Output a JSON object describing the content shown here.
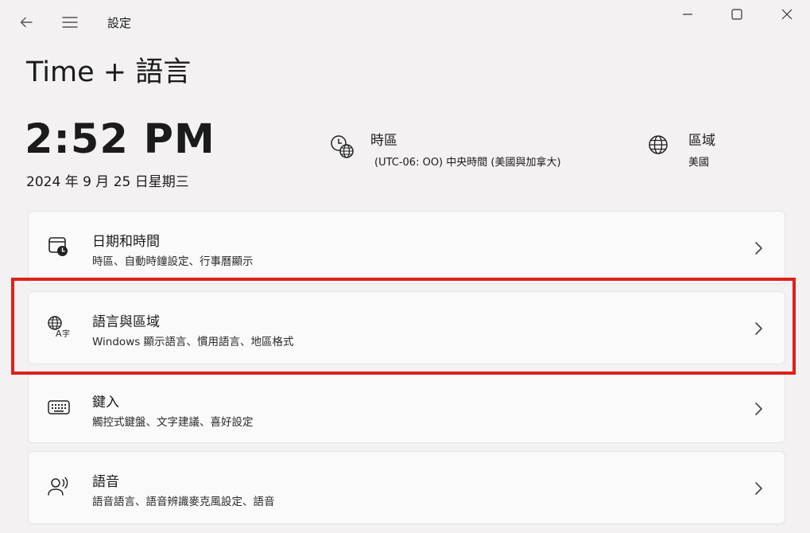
{
  "window": {
    "app_title": "設定",
    "back_icon": "back-arrow-icon",
    "menu_icon": "hamburger-menu-icon"
  },
  "page": {
    "title": "Time + 語言"
  },
  "clock": {
    "time": "2:52 PM",
    "date": "2024 年 9 月 25 日星期三"
  },
  "timezone": {
    "label": "時區",
    "value": "(UTC-06: OO) 中央時間 (美國與加拿大)",
    "icon": "timezone-clock-globe-icon"
  },
  "region": {
    "label": "區域",
    "value": "美國",
    "icon": "globe-icon"
  },
  "cards": [
    {
      "title": "日期和時間",
      "subtitle": "時區、自動時鐘設定、行事曆顯示",
      "icon": "calendar-clock-icon"
    },
    {
      "title": "語言與區域",
      "subtitle": "Windows 顯示語言、慣用語言、地區格式",
      "icon": "language-icon"
    },
    {
      "title": "鍵入",
      "subtitle": "觸控式鍵盤、文字建議、喜好設定",
      "icon": "keyboard-icon"
    },
    {
      "title": "語音",
      "subtitle": "語音語言、語音辨識麥克風設定、語音",
      "icon": "speech-icon"
    }
  ],
  "colors": {
    "highlight": "#e0201b",
    "background": "#f3f1f1",
    "card": "#fbfafa"
  }
}
